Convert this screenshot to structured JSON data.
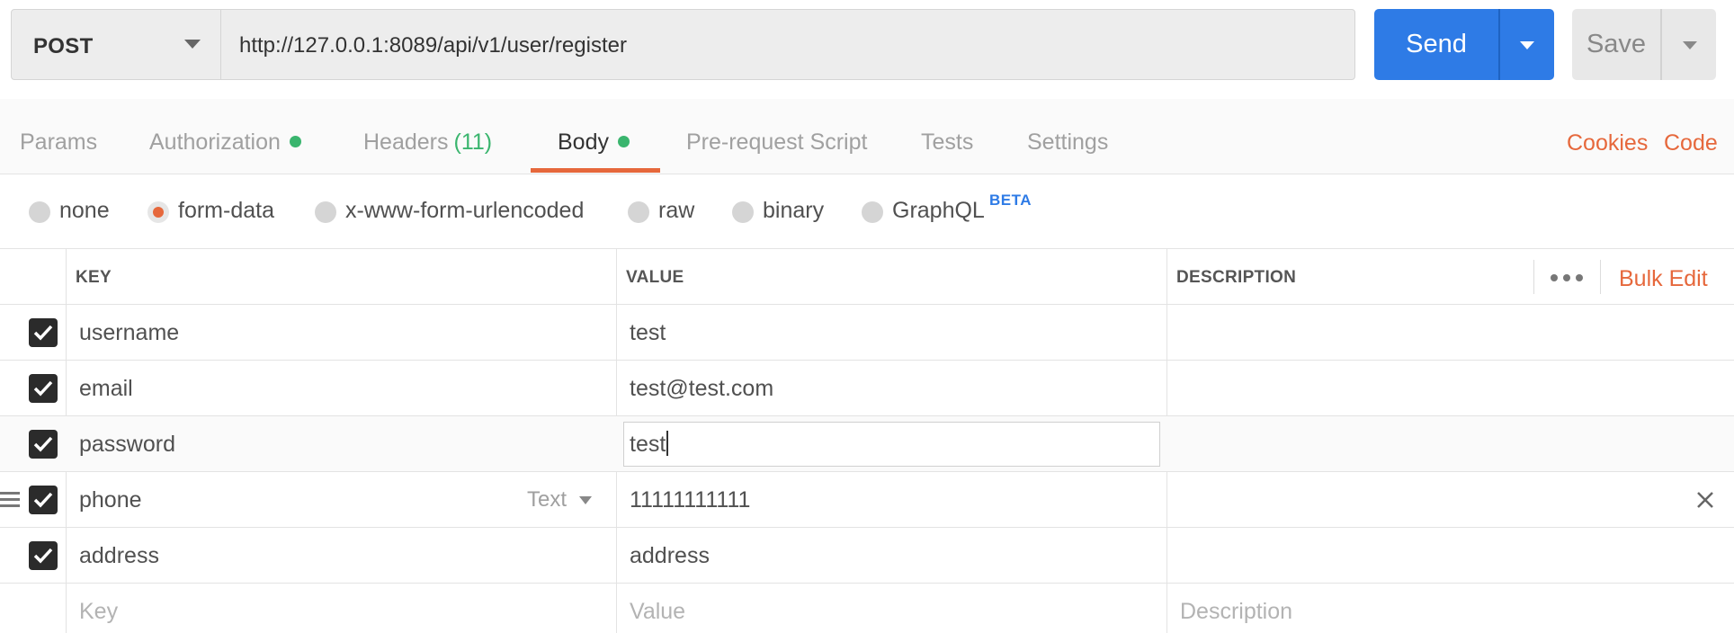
{
  "request": {
    "method": "POST",
    "url": "http://127.0.0.1:8089/api/v1/user/register",
    "send_label": "Send",
    "save_label": "Save"
  },
  "tabs": [
    {
      "label": "Params",
      "indicator": null,
      "count": null,
      "active": false
    },
    {
      "label": "Authorization",
      "indicator": "green-dot",
      "count": null,
      "active": false
    },
    {
      "label": "Headers",
      "indicator": null,
      "count": "(11)",
      "active": false
    },
    {
      "label": "Body",
      "indicator": "green-dot",
      "count": null,
      "active": true
    },
    {
      "label": "Pre-request Script",
      "indicator": null,
      "count": null,
      "active": false
    },
    {
      "label": "Tests",
      "indicator": null,
      "count": null,
      "active": false
    },
    {
      "label": "Settings",
      "indicator": null,
      "count": null,
      "active": false
    }
  ],
  "right_links": {
    "cookies": "Cookies",
    "code": "Code"
  },
  "body_types": [
    {
      "label": "none",
      "selected": false
    },
    {
      "label": "form-data",
      "selected": true
    },
    {
      "label": "x-www-form-urlencoded",
      "selected": false
    },
    {
      "label": "raw",
      "selected": false
    },
    {
      "label": "binary",
      "selected": false
    },
    {
      "label": "GraphQL",
      "selected": false
    }
  ],
  "beta_badge": "BETA",
  "table": {
    "headers": {
      "key": "KEY",
      "value": "VALUE",
      "description": "DESCRIPTION"
    },
    "bulk_edit": "Bulk Edit",
    "rows": [
      {
        "checked": true,
        "key": "username",
        "value": "test",
        "description": ""
      },
      {
        "checked": true,
        "key": "email",
        "value": "test@test.com",
        "description": ""
      },
      {
        "checked": true,
        "key": "password",
        "value": "test",
        "description": ""
      },
      {
        "checked": true,
        "key": "phone",
        "type": "Text",
        "value": "11111111111",
        "description": ""
      },
      {
        "checked": true,
        "key": "address",
        "value": "address",
        "description": ""
      }
    ],
    "new_row": {
      "key": "Key",
      "value": "Value",
      "description": "Description"
    }
  },
  "colors": {
    "accent_orange": "#e6683c",
    "send_blue": "#2e7be6",
    "status_green": "#3ab56e"
  }
}
